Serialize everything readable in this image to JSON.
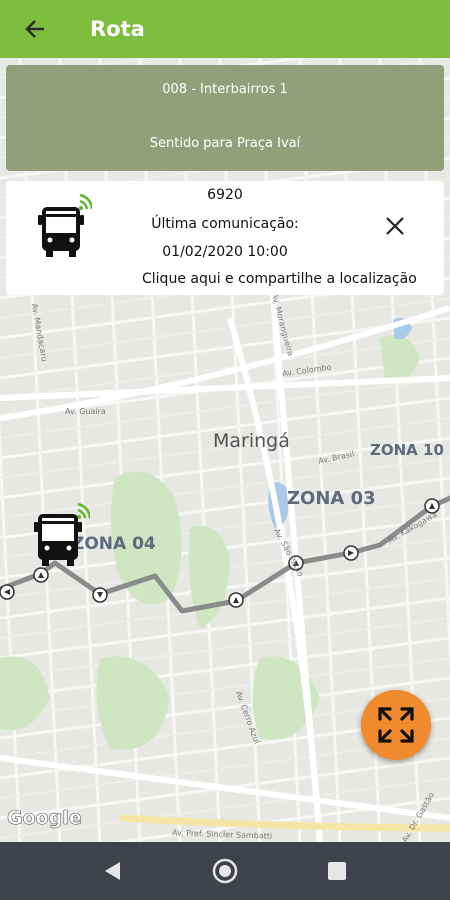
{
  "appbar": {
    "title": "Rota"
  },
  "route_card": {
    "line_name": "008 - Interbairros 1",
    "direction": "Sentido para Praça Ivaí"
  },
  "vehicle_card": {
    "vehicle_number": "6920",
    "last_comm_label": "Última comunicação:",
    "last_comm_datetime": "01/02/2020 10:00",
    "share_text": "Clique aqui e compartilhe a localização"
  },
  "map": {
    "city_label": "Maringá",
    "zones": [
      "ZONA 10",
      "ZONA 03",
      "ZONA 04"
    ],
    "streets": [
      "Av. Guaíra",
      "Av. Brasil",
      "Av. Colombo",
      "Av. São Paulo",
      "Av. Cerro Azul",
      "Av. Pref. Sincler Sambatti",
      "Av. Dr. Gastão",
      "Av. Mandacaru",
      "Av. Morangueira",
      "Av. Kakogawa"
    ],
    "attribution": "Google"
  },
  "colors": {
    "appbar": "#7cbd3e",
    "route_card": "#929f7a",
    "fab": "#f08a2e",
    "route_line": "#8b8b8b",
    "navbar": "#3f4349"
  },
  "icons": [
    "back-arrow-icon",
    "bus-wifi-icon",
    "close-icon",
    "expand-arrows-icon",
    "nav-back-icon",
    "nav-home-icon",
    "nav-recents-icon"
  ]
}
